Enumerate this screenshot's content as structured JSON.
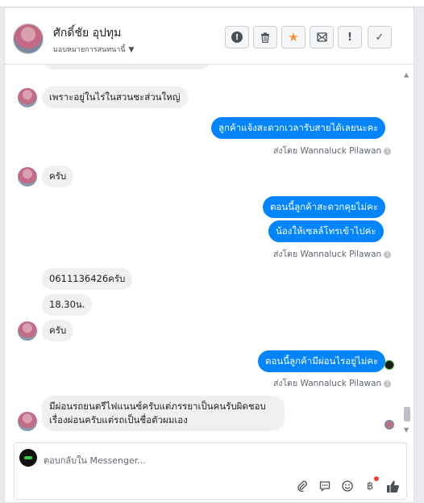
{
  "header": {
    "name": "ศักดิ์ชัย อุปทุม",
    "assign_label": "มอบหมายการสนทนานี้",
    "actions": [
      "warning-circle",
      "trash",
      "star",
      "mail-read",
      "exclamation",
      "check"
    ]
  },
  "messages": {
    "m1": "เพราะอยู่ในไร่ในสวนชะส่วนใหญ่",
    "m2": "ลูกค้าแจ้งสะดวกเวลารับสายได้เลยนะคะ",
    "sent_by_1": "ส่งโดย",
    "agent": "Wannaluck Pilawan",
    "m3": "ครับ",
    "m4": "ตอนนี้ลูกค้าสะดวกคุยไม่คะ",
    "m5": "น้องให้เซลล์โทรเข้าไปค่ะ",
    "m6": "0611136426ครับ",
    "m7": "18.30น.",
    "m8": "ครับ",
    "m9": "ตอนนี้ลูกค้ามีผ่อนไรอยู่ไม่คะ",
    "m10_line1": "มีผ่อนรถยนตรีไฟแนนซ์ครับแต่ภรรยาเป็นคนรับผิดชอบ",
    "m10_line2": "เรื่องผ่อนครับแต่รถเป็นชื่อตัวผมเอง"
  },
  "composer": {
    "placeholder": "ตอบกลับใน Messenger..."
  },
  "colors": {
    "outgoing": "#0084ff",
    "incoming": "#f1f0f0",
    "star": "#f7923b"
  }
}
